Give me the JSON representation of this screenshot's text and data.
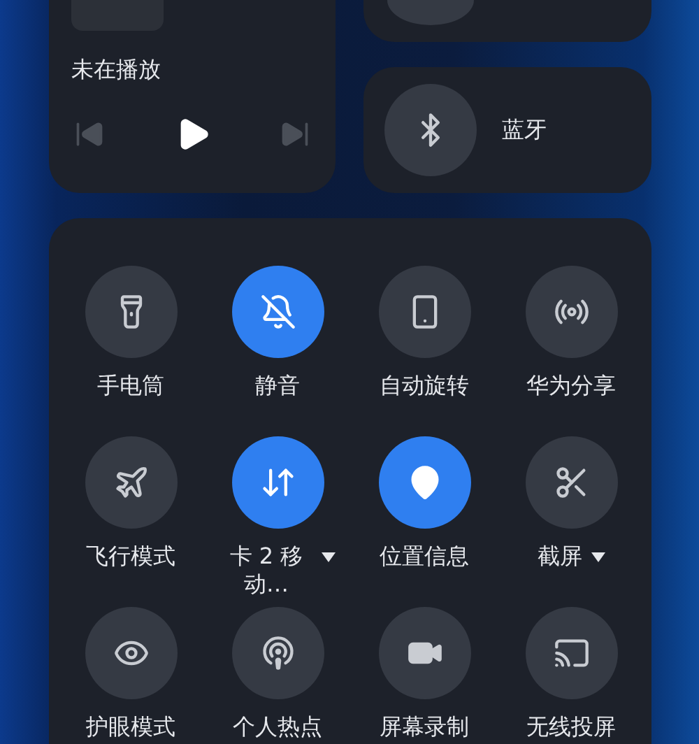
{
  "media": {
    "status": "未在播放",
    "playing": false
  },
  "bluetooth": {
    "label": "蓝牙",
    "on": false
  },
  "tiles": [
    {
      "kind": "flashlight",
      "label": "手电筒",
      "on": false,
      "menu": false
    },
    {
      "kind": "mute",
      "label": "静音",
      "on": true,
      "menu": false
    },
    {
      "kind": "rotate",
      "label": "自动旋转",
      "on": false,
      "menu": false
    },
    {
      "kind": "share",
      "label": "华为分享",
      "on": false,
      "menu": false
    },
    {
      "kind": "airplane",
      "label": "飞行模式",
      "on": false,
      "menu": false
    },
    {
      "kind": "data",
      "label": "卡 2 移动…",
      "on": true,
      "menu": true
    },
    {
      "kind": "location",
      "label": "位置信息",
      "on": true,
      "menu": false
    },
    {
      "kind": "screenshot",
      "label": "截屏",
      "on": false,
      "menu": true
    },
    {
      "kind": "eye",
      "label": "护眼模式",
      "on": false,
      "menu": false
    },
    {
      "kind": "hotspot",
      "label": "个人热点",
      "on": false,
      "menu": false
    },
    {
      "kind": "record",
      "label": "屏幕录制",
      "on": false,
      "menu": false
    },
    {
      "kind": "cast",
      "label": "无线投屏",
      "on": false,
      "menu": false
    }
  ]
}
